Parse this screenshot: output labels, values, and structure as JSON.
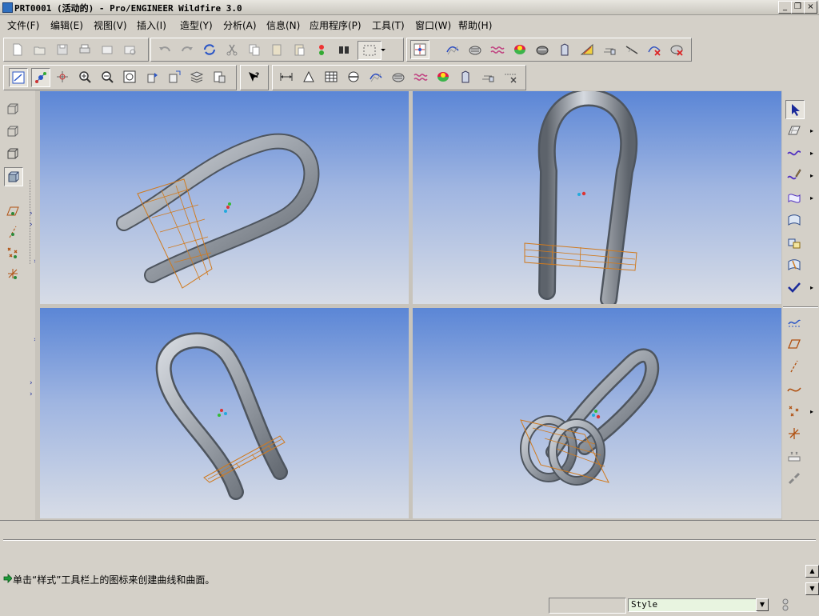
{
  "window": {
    "title": "PRT0001 (活动的) - Pro/ENGINEER Wildfire 3.0",
    "controls": [
      "_",
      "❐",
      "×"
    ]
  },
  "menu": [
    {
      "label": "文件(F)"
    },
    {
      "label": "编辑(E)"
    },
    {
      "label": "视图(V)"
    },
    {
      "label": "插入(I)"
    },
    {
      "label": "造型(Y)"
    },
    {
      "label": "分析(A)"
    },
    {
      "label": "信息(N)"
    },
    {
      "label": "应用程序(P)"
    },
    {
      "label": "工具(T)"
    },
    {
      "label": "窗口(W)"
    },
    {
      "label": "帮助(H)"
    }
  ],
  "message": {
    "text": "单击“样式”工具栏上的图标来创建曲线和曲面。"
  },
  "status": {
    "filter_value": "Style"
  },
  "colors": {
    "model": "#8a9099",
    "plane": "#d07a1e",
    "viewport_top": "#5b86d6",
    "viewport_bottom": "#d7dce6"
  }
}
